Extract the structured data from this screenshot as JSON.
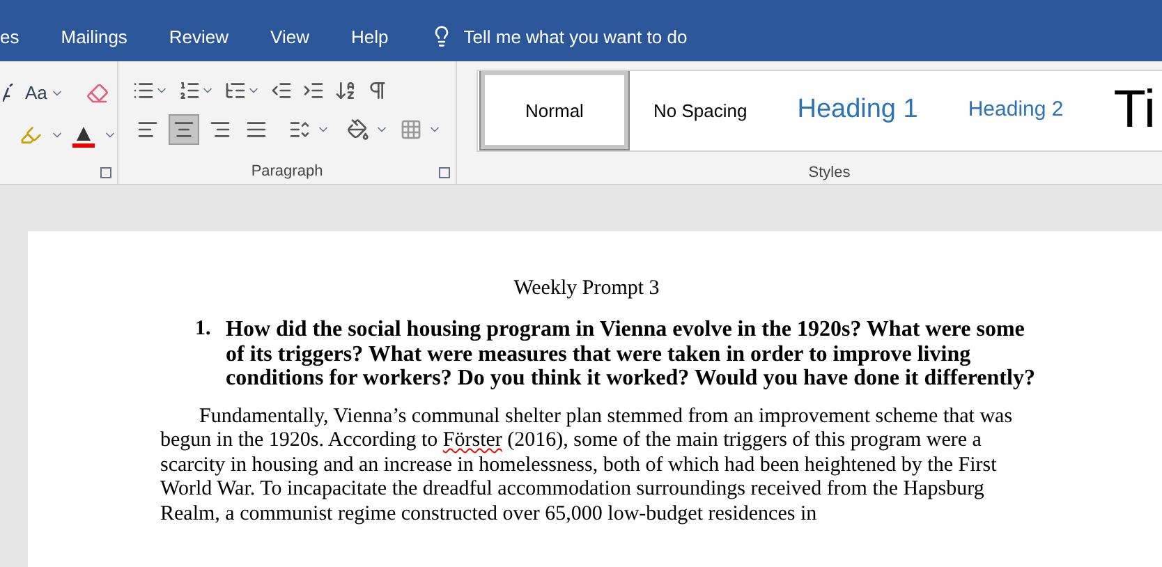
{
  "ribbon_tabs": [
    {
      "label": "es",
      "selected": false
    },
    {
      "label": "Mailings",
      "selected": false
    },
    {
      "label": "Review",
      "selected": false
    },
    {
      "label": "View",
      "selected": false
    },
    {
      "label": "Help",
      "selected": false
    }
  ],
  "tell_me": {
    "placeholder": "Tell me what you want to do"
  },
  "font_group": {
    "change_case": "Aa"
  },
  "paragraph_group": {
    "label": "Paragraph",
    "row1": [
      {
        "kind": "bullets"
      },
      {
        "kind": "numbering"
      },
      {
        "kind": "multilevel"
      },
      {
        "kind": "outdent"
      },
      {
        "kind": "indent"
      },
      {
        "kind": "sort"
      },
      {
        "kind": "pilcrow"
      }
    ],
    "align": [
      {
        "kind": "left",
        "selected": false
      },
      {
        "kind": "center",
        "selected": true
      },
      {
        "kind": "right",
        "selected": false
      },
      {
        "kind": "justify",
        "selected": false
      }
    ]
  },
  "styles_group": {
    "label": "Styles",
    "items": [
      {
        "label": "Normal",
        "kind": "normal",
        "selected": true
      },
      {
        "label": "No Spacing",
        "kind": "normal",
        "selected": false
      },
      {
        "label": "Heading 1",
        "kind": "heading1",
        "selected": false
      },
      {
        "label": "Heading 2",
        "kind": "heading2",
        "selected": false
      },
      {
        "label": "Ti",
        "kind": "title",
        "selected": false
      }
    ]
  },
  "document": {
    "title": "Weekly Prompt 3",
    "question": {
      "number": "1.",
      "text": "How did the social housing program in Vienna evolve in the 1920s? What were some of its triggers? What were measures that were taken in order to improve living conditions for workers? Do you think it worked? Would you have done it differently?"
    },
    "paragraph": [
      {
        "text": "Fundamentally, Vienna’s communal shelter plan stemmed from an improvement scheme that was begun in the 1920s. According to ",
        "misspelled": false
      },
      {
        "text": "Förster",
        "misspelled": true
      },
      {
        "text": " (2016), some of the main triggers of this program were a scarcity in housing and an increase in homelessness, both of which had been heightened by the First World War. To incapacitate the dreadful accommodation surroundings received from the Hapsburg Realm, a communist regime constructed over 65,000 low-budget residences in",
        "misspelled": false
      }
    ]
  }
}
